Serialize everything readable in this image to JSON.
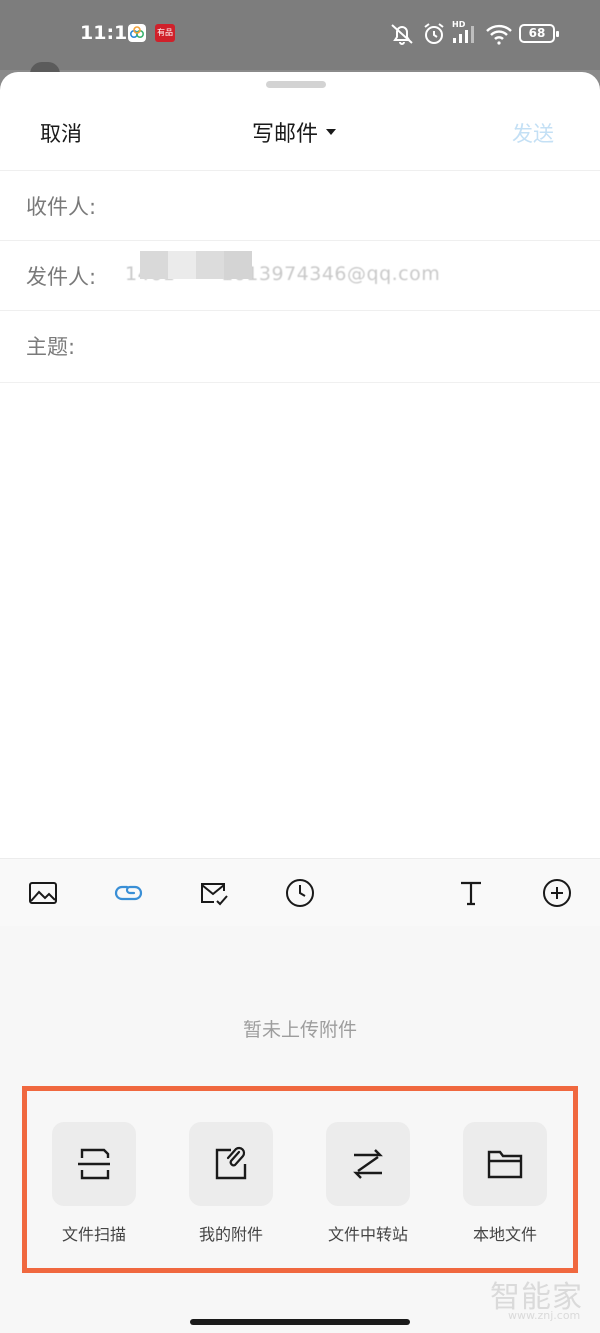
{
  "status_bar": {
    "time": "11:13",
    "notification_badge": "有品",
    "battery": "68",
    "signal_label": "HD"
  },
  "compose": {
    "cancel_label": "取消",
    "title": "写邮件",
    "send_label": "发送",
    "fields": {
      "to_label": "收件人:",
      "from_label": "发件人:",
      "from_value": "1461  ··· ·   1013974346@qq.com",
      "subject_label": "主题:"
    }
  },
  "toolbar": {
    "icons": [
      "image-icon",
      "attachment-icon",
      "mail-check-icon",
      "clock-icon",
      "text-format-icon",
      "plus-circle-icon"
    ],
    "active_color": "#3a8fd6"
  },
  "attachments": {
    "empty_text": "暂未上传附件",
    "actions": [
      {
        "label": "文件扫描",
        "icon": "document-scan-icon"
      },
      {
        "label": "我的附件",
        "icon": "my-attachment-icon"
      },
      {
        "label": "文件中转站",
        "icon": "file-transfer-icon"
      },
      {
        "label": "本地文件",
        "icon": "folder-icon"
      }
    ],
    "highlight_color": "#f0683f"
  },
  "watermark": {
    "title": "智能家",
    "url": "www.znj.com"
  }
}
